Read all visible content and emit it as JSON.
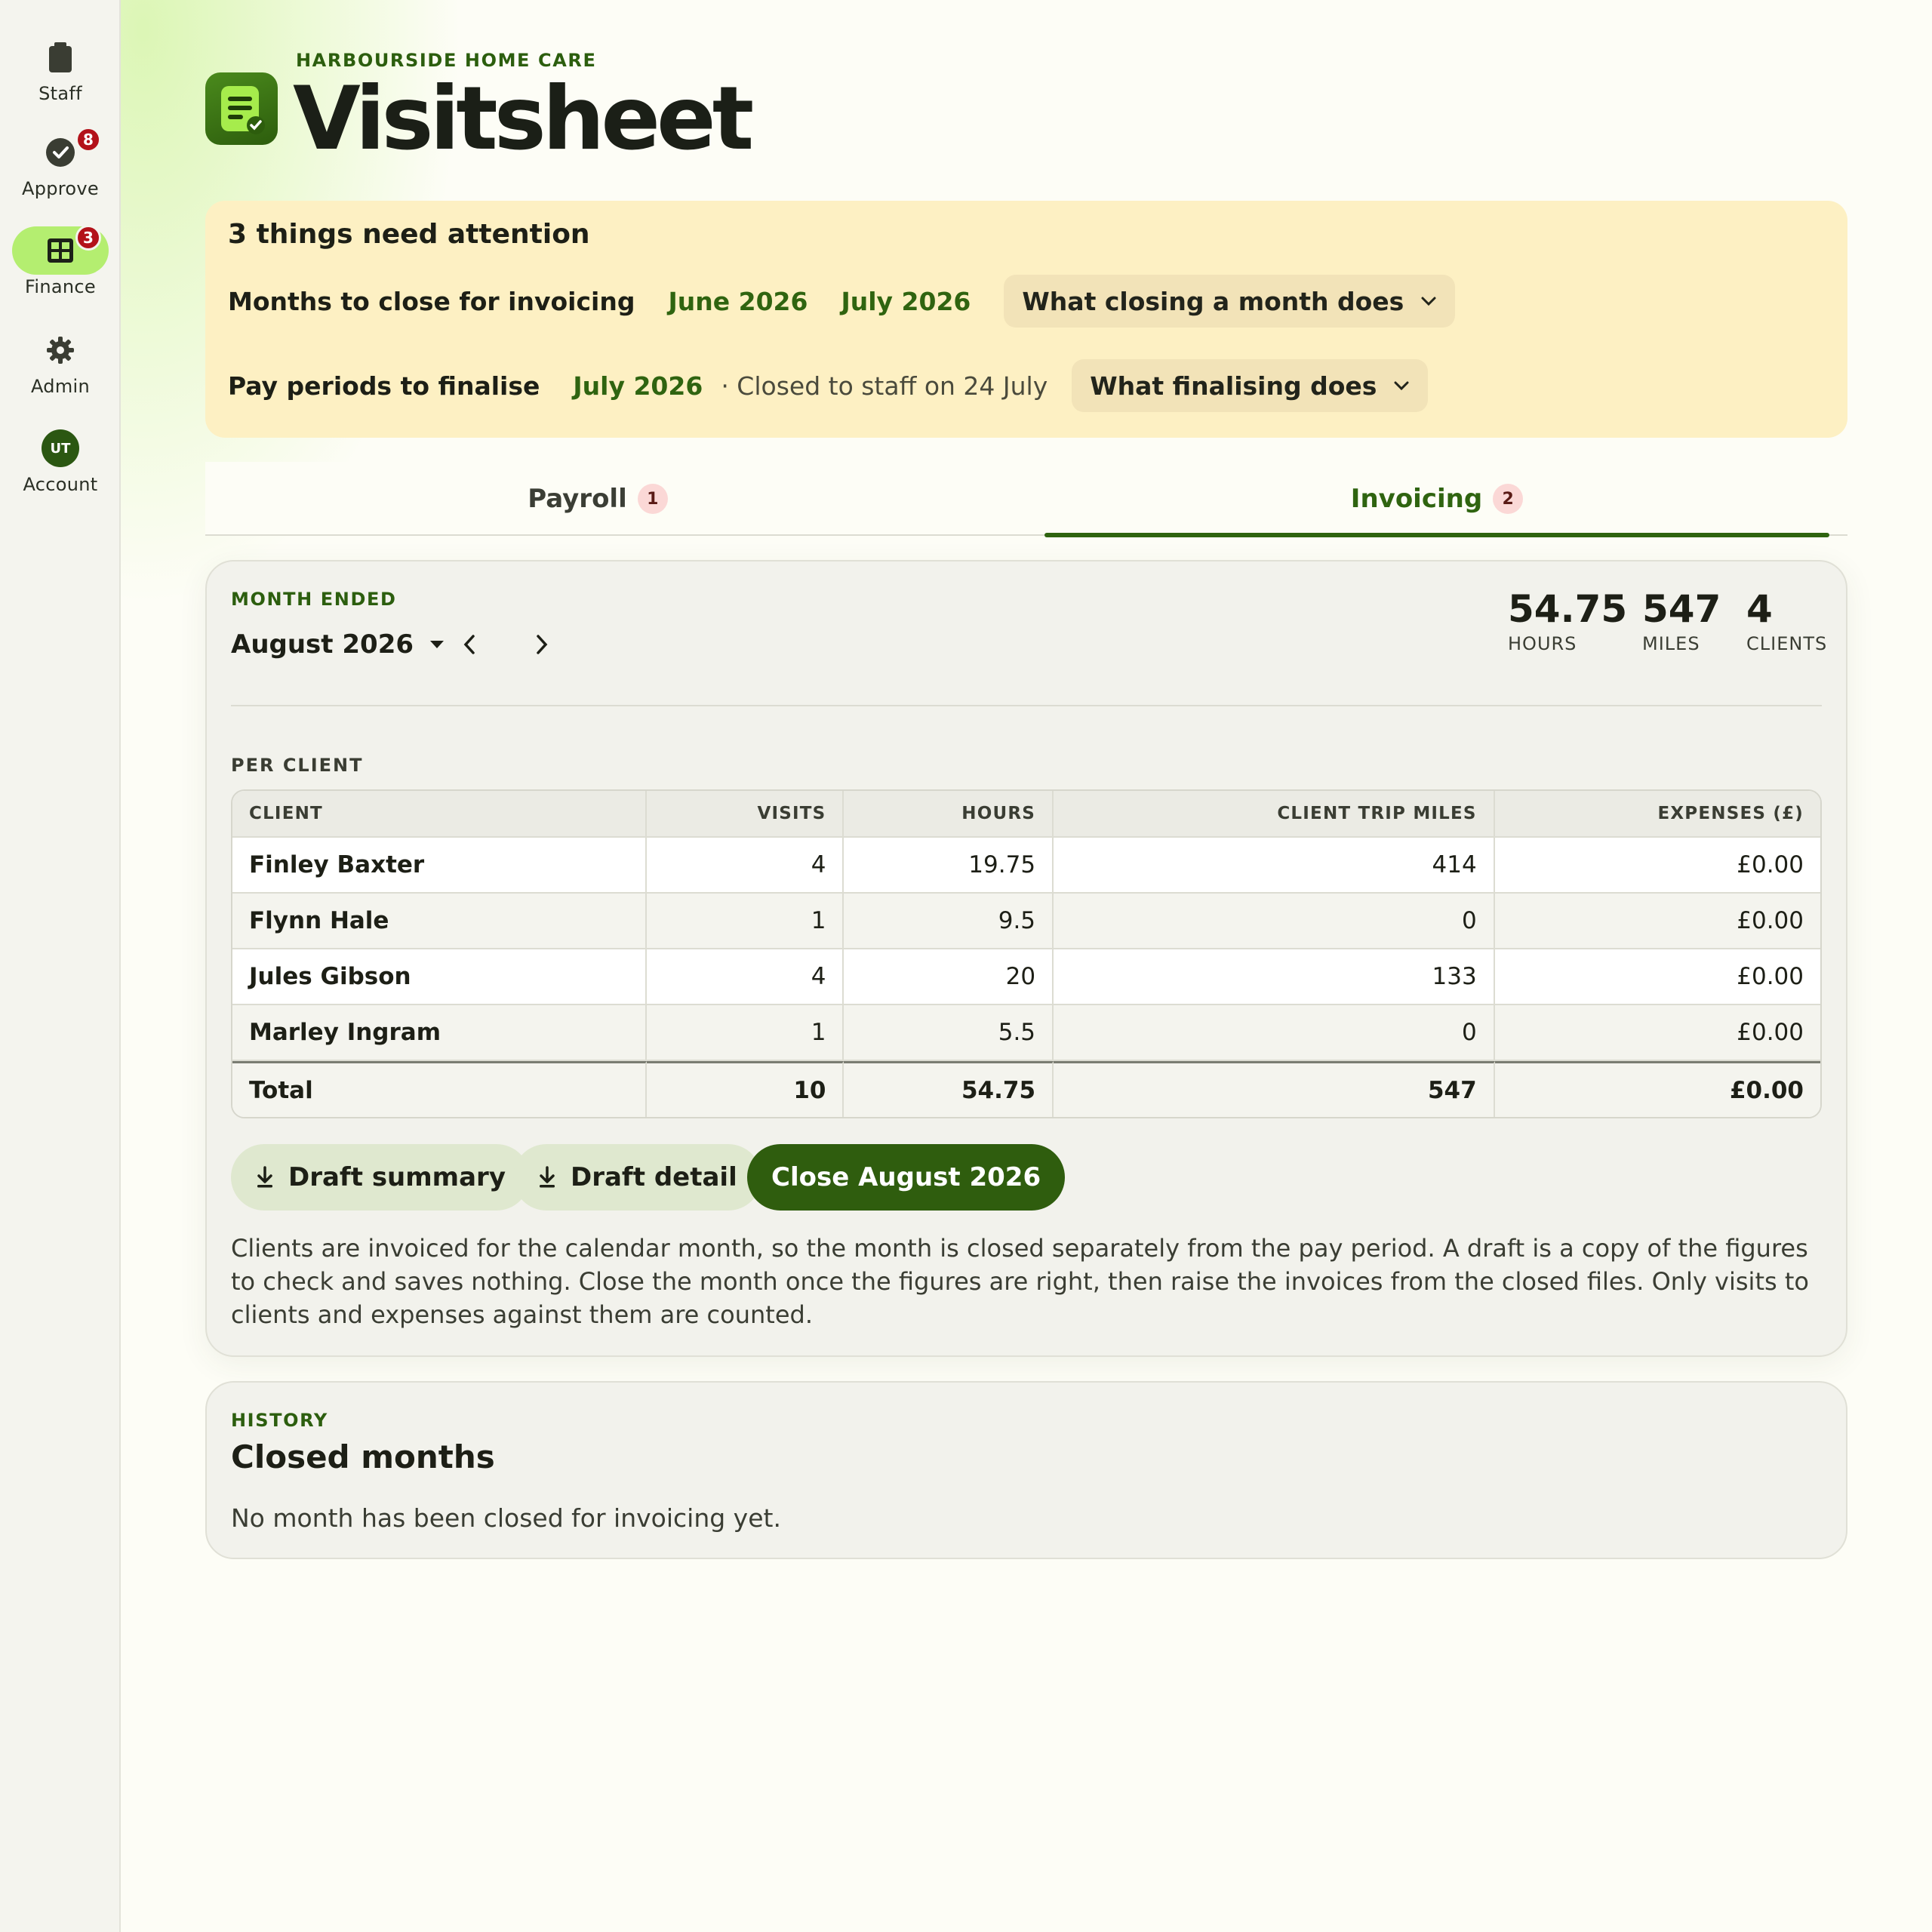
{
  "sidebar": {
    "items": [
      {
        "label": "Staff",
        "icon": "clipboard-icon"
      },
      {
        "label": "Approve",
        "icon": "check-circle-icon",
        "badge": "8"
      },
      {
        "label": "Finance",
        "icon": "grid-icon",
        "badge": "3",
        "active": true
      },
      {
        "label": "Admin",
        "icon": "gear-icon"
      },
      {
        "label": "Account",
        "icon": "avatar",
        "initials": "UT"
      }
    ]
  },
  "header": {
    "org": "HARBOURSIDE HOME CARE",
    "title": "Visitsheet"
  },
  "attention": {
    "title": "3 things need attention",
    "months_label": "Months to close for invoicing",
    "months": [
      "June 2026",
      "July 2026"
    ],
    "months_explain": "What closing a month does",
    "pay_label": "Pay periods to finalise",
    "pay_period": "July 2026",
    "pay_note": "· Closed to staff on 24 July",
    "pay_explain": "What finalising does"
  },
  "tabs": [
    {
      "label": "Payroll",
      "badge": "1"
    },
    {
      "label": "Invoicing",
      "badge": "2",
      "active": true
    }
  ],
  "invoicing": {
    "eyebrow": "MONTH ENDED",
    "month": "August 2026",
    "stats": [
      {
        "value": "54.75",
        "label": "HOURS"
      },
      {
        "value": "547",
        "label": "MILES"
      },
      {
        "value": "4",
        "label": "CLIENTS"
      }
    ],
    "per_client_label": "PER CLIENT",
    "columns": [
      "CLIENT",
      "VISITS",
      "HOURS",
      "CLIENT TRIP MILES",
      "EXPENSES (£)"
    ],
    "rows": [
      [
        "Finley Baxter",
        "4",
        "19.75",
        "414",
        "£0.00"
      ],
      [
        "Flynn Hale",
        "1",
        "9.5",
        "0",
        "£0.00"
      ],
      [
        "Jules Gibson",
        "4",
        "20",
        "133",
        "£0.00"
      ],
      [
        "Marley Ingram",
        "1",
        "5.5",
        "0",
        "£0.00"
      ]
    ],
    "total": [
      "Total",
      "10",
      "54.75",
      "547",
      "£0.00"
    ],
    "buttons": {
      "draft_summary": "Draft summary",
      "draft_detail": "Draft detail",
      "close": "Close August 2026"
    },
    "help": "Clients are invoiced for the calendar month, so the month is closed separately from the pay period. A draft is a copy of the figures to check and saves nothing. Close the month once the figures are right, then raise the invoices from the closed files. Only visits to clients and expenses against them are counted."
  },
  "history": {
    "eyebrow": "HISTORY",
    "title": "Closed months",
    "empty": "No month has been closed for invoicing yet."
  },
  "colors": {
    "accent": "#2f6410",
    "active_nav": "#b4ee70",
    "badge": "#b3121a",
    "banner": "#fdf0c3"
  }
}
